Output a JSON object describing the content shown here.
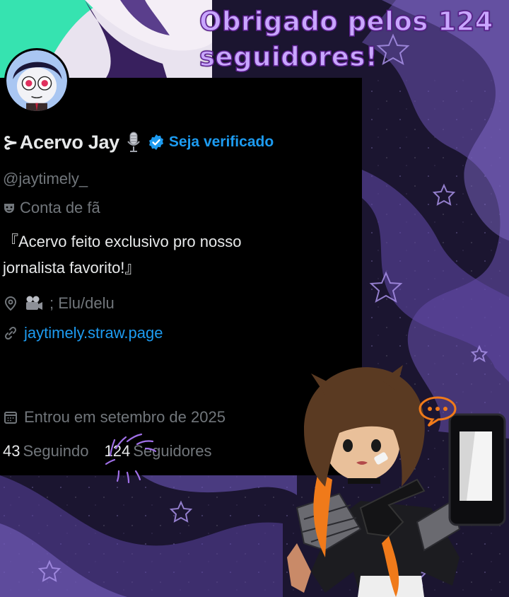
{
  "headline": {
    "line1": "Obrigado pelos 124",
    "line2": "seguidores!"
  },
  "profile": {
    "name_prefix": "⊱",
    "display_name": "Acervo Jay",
    "name_emoji_icon": "microphone-icon",
    "verified_icon": "verified-badge-icon",
    "verify_link": "Seja verificado",
    "handle": "@jaytimely_",
    "category": "Conta de fã",
    "category_icon": "theater-mask-icon",
    "bio_line1": "『Acervo feito exclusivo pro nosso",
    "bio_line2": "jornalista favorito!』",
    "location": "; Elu/delu",
    "location_icon": "map-pin-icon",
    "location_emoji_icon": "movie-camera-icon",
    "website": "jaytimely.straw.page",
    "website_icon": "link-icon",
    "joined": "Entrou em setembro de 2025",
    "joined_icon": "calendar-icon",
    "following_count": "43",
    "following_label": "Seguindo",
    "followers_count": "124",
    "followers_label": "Seguidores"
  },
  "colors": {
    "card_bg": "#000000",
    "text_primary": "#e7e9ea",
    "text_muted": "#71767b",
    "link_blue": "#1d9bf0",
    "headline_fill": "#c9a6ff",
    "headline_outline": "#5a1f8c",
    "background_purple": "#1d1633",
    "swirl_purple": "#7c5fc4"
  }
}
